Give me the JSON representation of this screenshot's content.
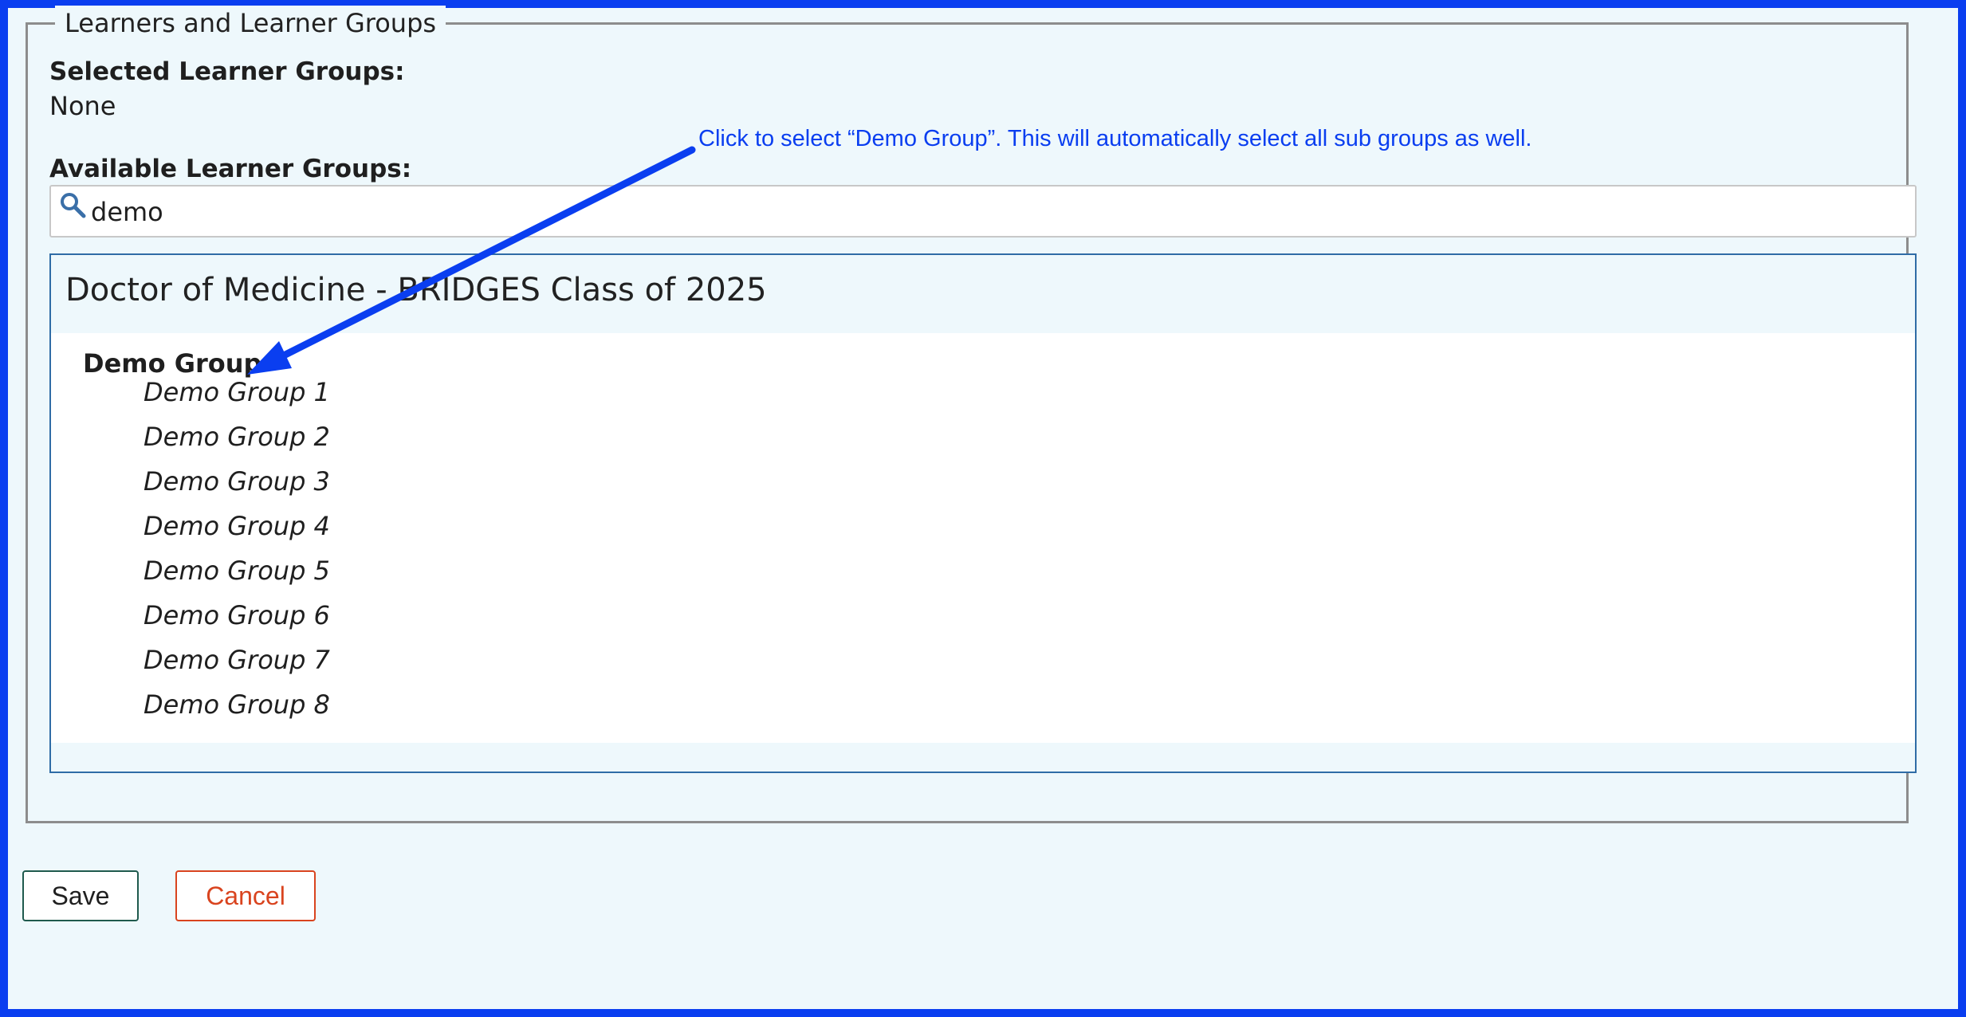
{
  "fieldset": {
    "legend": "Learners and Learner Groups"
  },
  "selected": {
    "label": "Selected Learner Groups:",
    "value": "None"
  },
  "available": {
    "label": "Available Learner Groups:"
  },
  "search": {
    "value": "demo",
    "icon": "search-icon"
  },
  "results": {
    "program_title": "Doctor of Medicine - BRIDGES Class of 2025",
    "parent_group": "Demo Group",
    "subgroups": [
      "Demo Group 1",
      "Demo Group 2",
      "Demo Group 3",
      "Demo Group 4",
      "Demo Group 5",
      "Demo Group 6",
      "Demo Group 7",
      "Demo Group 8"
    ]
  },
  "actions": {
    "save_label": "Save",
    "cancel_label": "Cancel"
  },
  "annotation": {
    "text": "Click to select “Demo Group”. This will automatically select all sub groups as well.",
    "color": "#0a3ef0"
  },
  "colors": {
    "frame_border": "#0a3ef0",
    "panel_bg": "#eef8fc",
    "results_border": "#2f6ca6",
    "save_border": "#1f5a4d",
    "cancel_color": "#d9441f"
  }
}
